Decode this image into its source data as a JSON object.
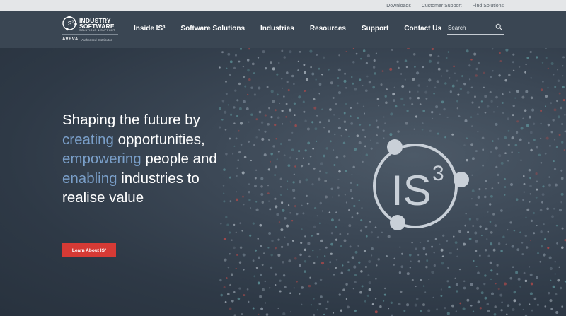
{
  "utility_nav": [
    "Downloads",
    "Customer Support",
    "Find Solutions"
  ],
  "logo": {
    "line1": "INDUSTRY",
    "line2": "SOFTWARE",
    "tagline": "SOLUTIONS & SUPPORT",
    "partner": "AVEVA",
    "partner_note": "Authorised Distributor"
  },
  "main_nav": [
    "Inside IS³",
    "Software Solutions",
    "Industries",
    "Resources",
    "Support",
    "Contact Us"
  ],
  "search": {
    "placeholder": "Search"
  },
  "hero": {
    "line1": "Shaping the future by",
    "line2_accent": "creating",
    "line2_rest": " opportunities,",
    "line3_accent": "empowering",
    "line3_rest": " people and",
    "line4_accent": "enabling",
    "line4_rest": " industries to",
    "line5": "realise value",
    "cta_label": "Learn About IS³",
    "emblem_main": "IS",
    "emblem_sup": "3"
  },
  "colors": {
    "header_bg": "#3a4653",
    "accent_text": "#7a9fc9",
    "cta_bg": "#d63a35",
    "utility_bg": "#e4e6e8"
  }
}
